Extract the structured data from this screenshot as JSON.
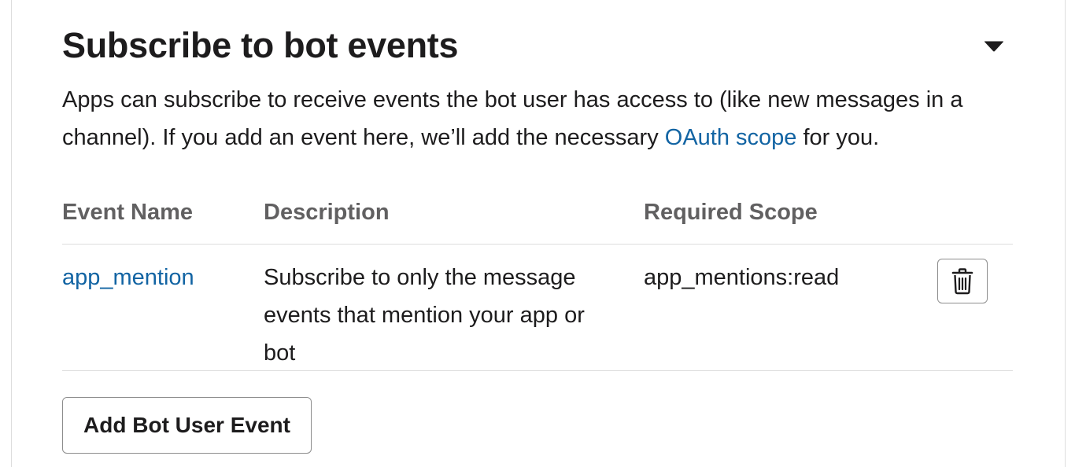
{
  "section": {
    "title": "Subscribe to bot events",
    "description_before_link": "Apps can subscribe to receive events the bot user has access to (like new messages in a channel). If you add an event here, we’ll add the necessary ",
    "description_link": "OAuth scope",
    "description_after_link": " for you.",
    "collapse_icon": "caret-down-icon"
  },
  "table": {
    "columns": [
      "Event Name",
      "Description",
      "Required Scope"
    ],
    "rows": [
      {
        "event_name": "app_mention",
        "description": "Subscribe to only the message events that mention your app or bot",
        "required_scope": "app_mentions:read",
        "action_icon": "trash-icon"
      }
    ]
  },
  "add_button_label": "Add Bot User Event",
  "colors": {
    "link": "#1264a3",
    "text": "#1d1c1d",
    "muted": "#616061",
    "border": "#dddddd"
  }
}
